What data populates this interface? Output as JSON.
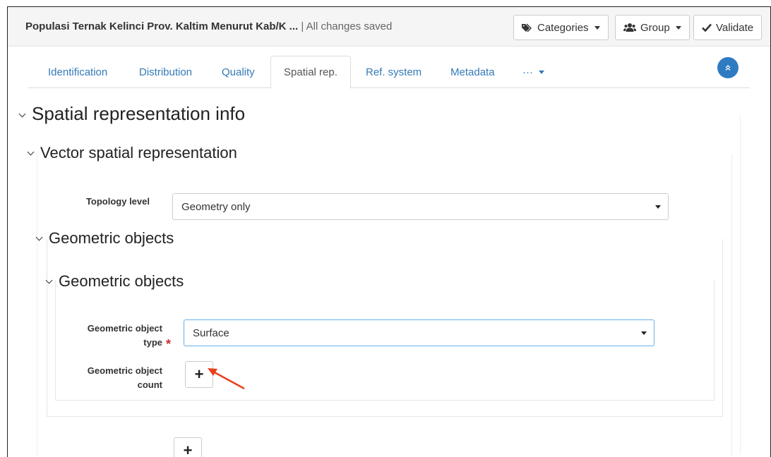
{
  "header": {
    "title": "Populasi Ternak Kelinci Prov. Kaltim Menurut Kab/K ...",
    "separator": "|",
    "status": "All changes saved",
    "categories_label": "Categories",
    "group_label": "Group",
    "validate_label": "Validate"
  },
  "tabs": [
    {
      "label": "Identification"
    },
    {
      "label": "Distribution"
    },
    {
      "label": "Quality"
    },
    {
      "label": "Spatial rep."
    },
    {
      "label": "Ref. system"
    },
    {
      "label": "Metadata"
    },
    {
      "label": "···"
    }
  ],
  "sections": {
    "spatial_info": "Spatial representation info",
    "vector": "Vector spatial representation",
    "geometric_outer": "Geometric objects",
    "geometric_inner": "Geometric objects"
  },
  "fields": {
    "topology_label": "Topology level",
    "topology_value": "Geometry only",
    "geo_type_label_1": "Geometric object",
    "geo_type_label_2": "type",
    "geo_type_value": "Surface",
    "geo_count_label_1": "Geometric object",
    "geo_count_label_2": "count",
    "required_mark": "*",
    "plus": "+"
  },
  "colors": {
    "link": "#337ab7",
    "required": "#c9302c",
    "annotation_arrow": "#e8401c",
    "scroll_button": "#2f7bc1"
  },
  "icons": [
    "tag-icon",
    "users-icon",
    "check-icon",
    "chevron-up-icon",
    "chevron-down-icon",
    "plus-icon",
    "arrow-annotation-icon"
  ]
}
